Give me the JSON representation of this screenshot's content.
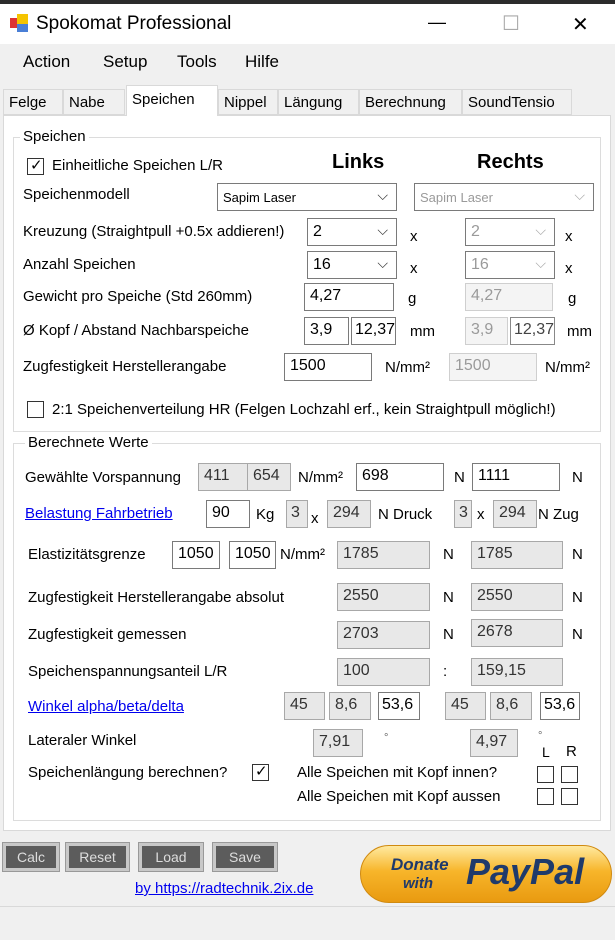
{
  "window": {
    "title": "Spokomat Professional",
    "minimize": "—",
    "maximize": "☐",
    "close": "✕"
  },
  "menu": [
    "Action",
    "Setup",
    "Tools",
    "Hilfe"
  ],
  "tabs": [
    "Felge",
    "Nabe",
    "Speichen",
    "Nippel",
    "Längung",
    "Berechnung",
    "SoundTensio"
  ],
  "active_tab": "Speichen",
  "speichen": {
    "group_label": "Speichen",
    "einheitlich_label": "Einheitliche Speichen L/R",
    "einheitlich_checked": true,
    "links": "Links",
    "rechts": "Rechts",
    "modell_label": "Speichenmodell",
    "modell_left": "Sapim Laser",
    "modell_right": "Sapim Laser",
    "kreuzung_label": "Kreuzung (Straightpull +0.5x addieren!)",
    "kreuzung_left": "2",
    "kreuzung_right": "2",
    "anzahl_label": "Anzahl Speichen",
    "anzahl_left": "16",
    "anzahl_right": "16",
    "x": "x",
    "gewicht_label": "Gewicht pro Speiche (Std 260mm)",
    "gewicht_left": "4,27",
    "gewicht_right": "4,27",
    "g": "g",
    "kopf_label": "Ø Kopf / Abstand Nachbarspeiche",
    "kopf_left": "3,9",
    "abstand_left": "12,37",
    "kopf_right": "3,9",
    "abstand_right": "12,37",
    "mm": "mm",
    "zug_label": "Zugfestigkeit Herstellerangabe",
    "zug_left": "1500",
    "zug_right": "1500",
    "nmm2": "N/mm²",
    "verteilung_label": "2:1 Speichenverteilung HR (Felgen Lochzahl erf., kein Straightpull möglich!)",
    "verteilung_checked": false
  },
  "berechnet": {
    "group_label": "Berechnete Werte",
    "vorspannung_label": "Gewählte Vorspannung",
    "vs1": "411",
    "vs2": "654",
    "vs_left": "698",
    "vs_right": "1111",
    "n": "N",
    "nmm2": "N/mm²",
    "belastung_label": "Belastung Fahrbetrieb",
    "kg_value": "90",
    "kg": "Kg",
    "druck_n": "3",
    "druck_val": "294",
    "druck": "N Druck",
    "zug_n": "3",
    "zug_val": "294",
    "zug": "N Zug",
    "x": "x",
    "elast_label": "Elastizitätsgrenze",
    "elast1": "1050",
    "elast2": "1050",
    "elast_left": "1785",
    "elast_right": "1785",
    "zabs_label": "Zugfestigkeit Herstellerangabe absolut",
    "zabs_left": "2550",
    "zabs_right": "2550",
    "zgem_label": "Zugfestigkeit gemessen",
    "zgem_left": "2703",
    "zgem_right": "2678",
    "anteil_label": "Speichenspannungsanteil L/R",
    "anteil_left": "100",
    "colon": ":",
    "anteil_right": "159,15",
    "winkel_label": "Winkel alpha/beta/delta",
    "wl": [
      "45",
      "8,6",
      "53,6"
    ],
    "wr": [
      "45",
      "8,6",
      "53,6"
    ],
    "lateral_label": "Lateraler Winkel",
    "lat_left": "7,91",
    "lat_right": "4,97",
    "deg": "°",
    "L": "L",
    "R": "R",
    "laengung_label": "Speichenlängung berechnen?",
    "laengung_checked": true,
    "innen_label": "Alle Speichen mit Kopf innen?",
    "aussen_label": "Alle Speichen mit Kopf aussen"
  },
  "buttons": {
    "calc": "Calc",
    "reset": "Reset",
    "load": "Load",
    "save": "Save"
  },
  "footer_link": "by https://radtechnik.2ix.de",
  "paypal": {
    "donate": "Donate",
    "with": "with",
    "brand": "PayPal"
  }
}
